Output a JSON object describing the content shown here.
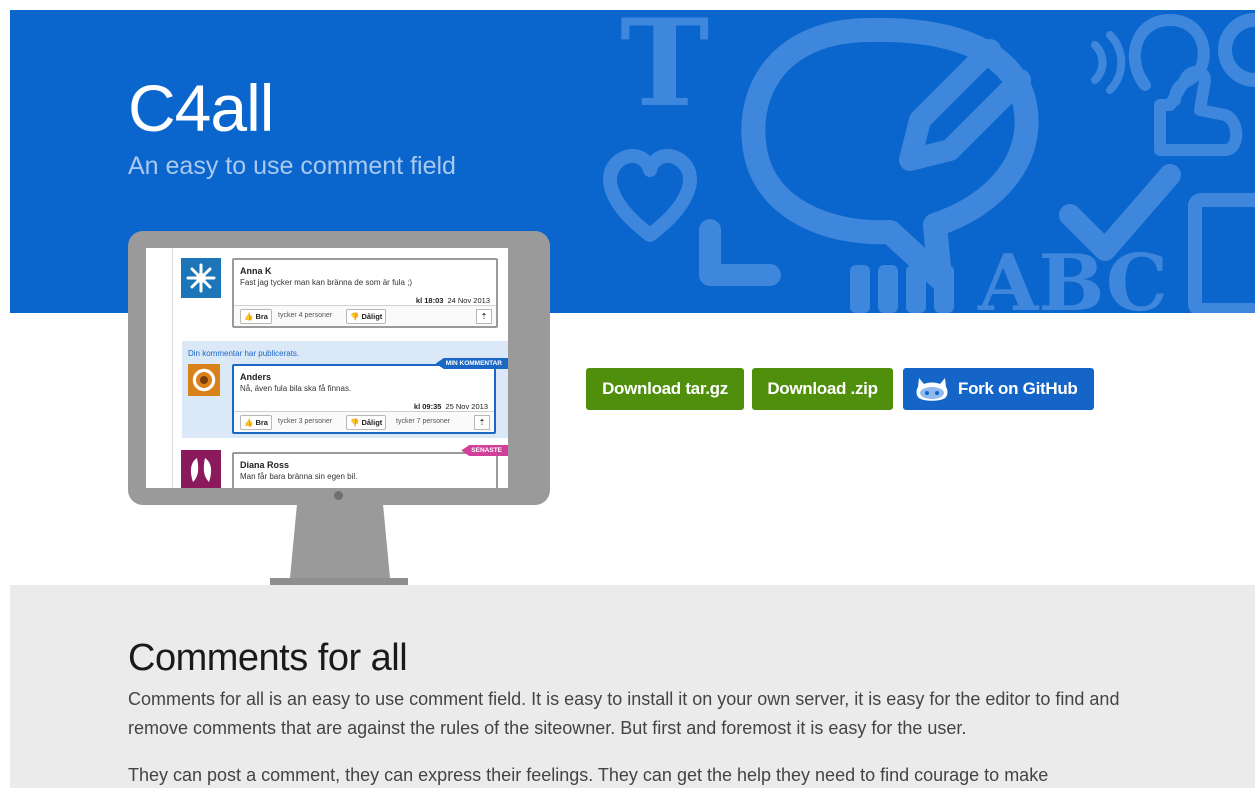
{
  "hero": {
    "title": "C4all",
    "tagline": "An easy to use comment field",
    "background_color": "#0a66cc"
  },
  "screen": {
    "comments": [
      {
        "author": "Anna K",
        "text": "Fast jag tycker man kan bränna de som är fula ;)",
        "time": "kl 18:03",
        "date": "24 Nov 2013",
        "like_label": "Bra",
        "like_count": "tycker 4 personer",
        "dislike_label": "Dåligt"
      },
      {
        "notice": "Din kommentar har publicerats.",
        "badge": "MIN KOMMENTAR",
        "author": "Anders",
        "text": "Nå, även fula bila ska få finnas.",
        "time": "kl 09:35",
        "date": "25 Nov 2013",
        "like_label": "Bra",
        "like_count": "tycker 3 personer",
        "dislike_label": "Dåligt",
        "dislike_count": "tycker 7 personer"
      },
      {
        "badge": "SENASTE",
        "author": "Diana Ross",
        "text": "Man får bara bränna sin egen bil."
      }
    ]
  },
  "actions": {
    "download_tar": "Download tar.gz",
    "download_zip": "Download .zip",
    "fork_github": "Fork on GitHub",
    "green": "#4f8f0b",
    "blue": "#1565c8"
  },
  "about": {
    "heading": "Comments for all",
    "paragraph1": "Comments for all is an easy to use comment field. It is easy to install it on your own server, it is easy for the editor to find and remove comments that are against the rules of the siteowner. But first and foremost it is easy for the user.",
    "paragraph2": "They can post a comment, they can express their feelings. They can get the help they need to find courage to make"
  }
}
